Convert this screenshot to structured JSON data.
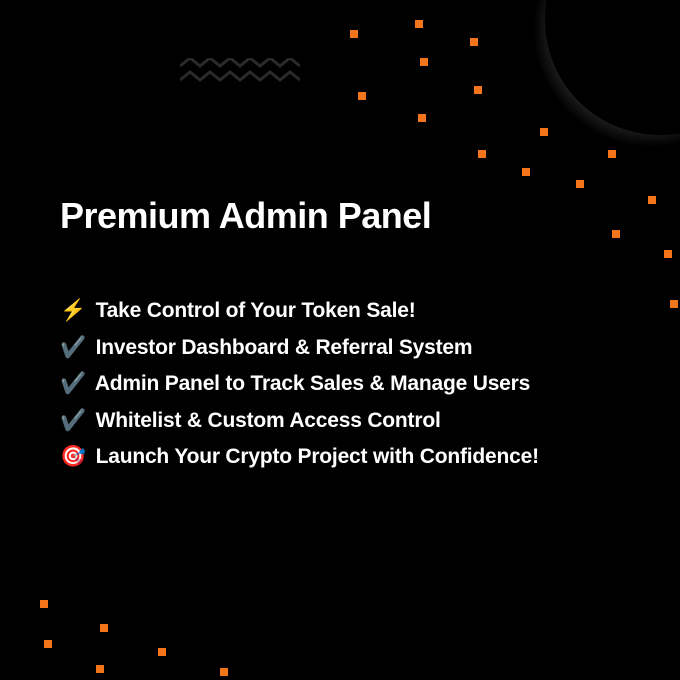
{
  "title": "Premium Admin Panel",
  "features": [
    {
      "icon": "⚡",
      "text": "Take Control of Your Token Sale!"
    },
    {
      "icon": "✔️",
      "text": "Investor Dashboard & Referral System"
    },
    {
      "icon": "✔️",
      "text": "Admin Panel to Track Sales & Manage Users"
    },
    {
      "icon": "✔️",
      "text": "Whitelist & Custom Access Control"
    },
    {
      "icon": "🎯",
      "text": "Launch Your Crypto Project with Confidence!"
    }
  ],
  "accent_color": "#f5761a"
}
